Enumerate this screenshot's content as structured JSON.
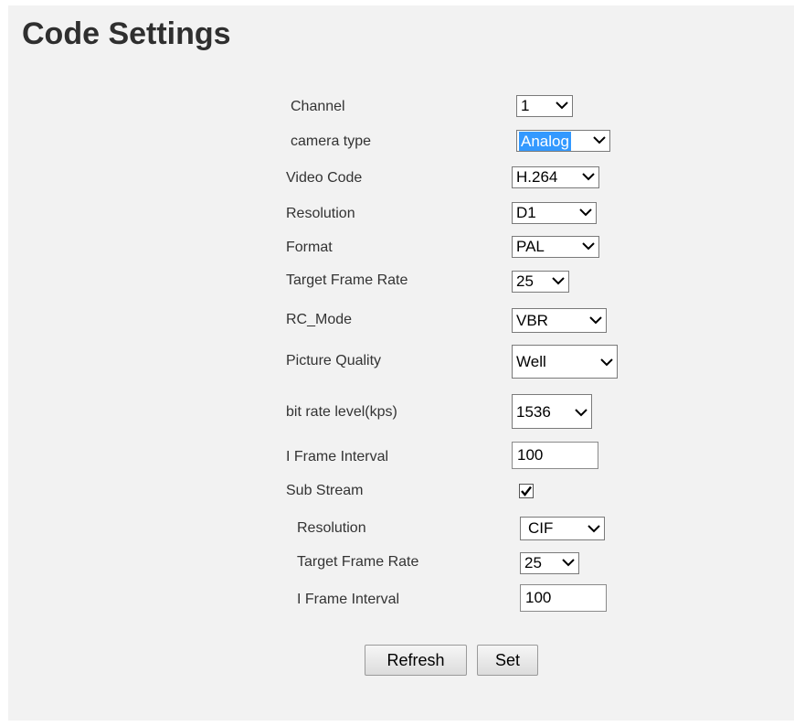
{
  "page": {
    "title": "Code Settings"
  },
  "form": {
    "channel": {
      "label": "Channel",
      "value": "1"
    },
    "camera_type": {
      "label": "camera type",
      "value": "Analog"
    },
    "video_code": {
      "label": "Video Code",
      "value": "H.264"
    },
    "resolution": {
      "label": "Resolution",
      "value": "D1"
    },
    "format": {
      "label": "Format",
      "value": "PAL"
    },
    "target_frame_rate": {
      "label": "Target Frame Rate",
      "value": "25"
    },
    "rc_mode": {
      "label": "RC_Mode",
      "value": "VBR"
    },
    "picture_quality": {
      "label": "Picture Quality",
      "value": "Well"
    },
    "bit_rate_level": {
      "label": "bit rate level(kps)",
      "value": "1536"
    },
    "i_frame_interval": {
      "label": "I Frame Interval",
      "value": "100"
    },
    "sub_stream": {
      "label": "Sub Stream",
      "checked": true
    },
    "sub_resolution": {
      "label": "Resolution",
      "value": "CIF"
    },
    "sub_target_frame_rate": {
      "label": "Target Frame Rate",
      "value": "25"
    },
    "sub_i_frame_interval": {
      "label": "I Frame Interval",
      "value": "100"
    }
  },
  "buttons": {
    "refresh": "Refresh",
    "set": "Set"
  },
  "icons": {
    "dropdown": "chevron-down-icon",
    "check": "checkmark-icon"
  }
}
